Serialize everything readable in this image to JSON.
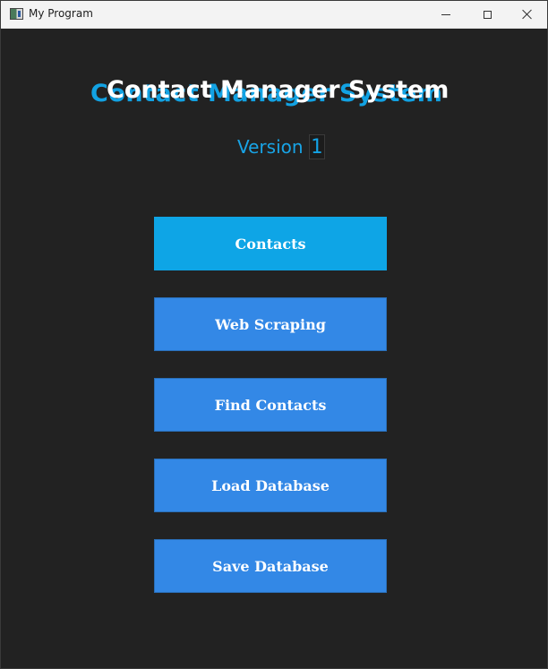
{
  "window": {
    "title": "My Program"
  },
  "header": {
    "title": "Contact Manager System",
    "version_label": "Version",
    "version_value": "1"
  },
  "menu": {
    "items": [
      {
        "label": "Contacts"
      },
      {
        "label": "Web Scraping"
      },
      {
        "label": "Find Contacts"
      },
      {
        "label": "Load Database"
      },
      {
        "label": "Save Database"
      }
    ]
  },
  "colors": {
    "background": "#222222",
    "accent": "#12a2e3",
    "button": "#3388e6",
    "button_active": "#0ea5e6"
  },
  "icons": {
    "app": "app-icon",
    "minimize": "minimize-icon",
    "maximize": "maximize-icon",
    "close": "close-icon"
  }
}
